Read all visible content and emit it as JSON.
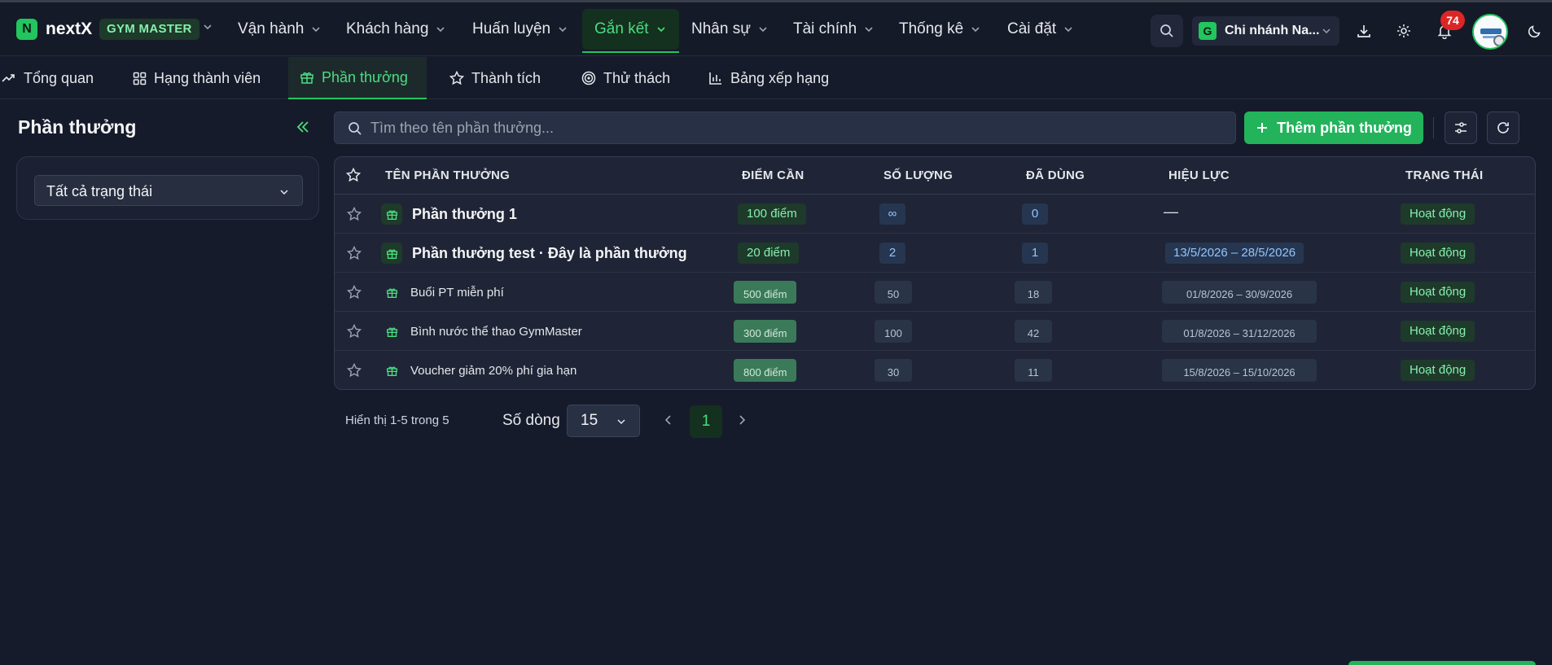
{
  "brand": {
    "logo_letter": "N",
    "name": "nextX",
    "badge": "GYM MASTER"
  },
  "nav": {
    "items": [
      {
        "label": "Vận hành"
      },
      {
        "label": "Khách hàng"
      },
      {
        "label": "Huấn luyện"
      },
      {
        "label": "Gắn kết",
        "active": true
      },
      {
        "label": "Nhân sự"
      },
      {
        "label": "Tài chính"
      },
      {
        "label": "Thống kê"
      },
      {
        "label": "Cài đặt"
      }
    ]
  },
  "header": {
    "branch_letter": "G",
    "branch_label": "Chi nhánh Na...",
    "notification_count": "74"
  },
  "subnav": {
    "tabs": [
      {
        "label": "Tổng quan",
        "icon": "trend-up-icon"
      },
      {
        "label": "Hạng thành viên",
        "icon": "grid-icon"
      },
      {
        "label": "Phần thưởng",
        "icon": "gift-icon",
        "active": true
      },
      {
        "label": "Thành tích",
        "icon": "star-icon"
      },
      {
        "label": "Thử thách",
        "icon": "target-icon"
      },
      {
        "label": "Bảng xếp hạng",
        "icon": "bar-chart-icon"
      }
    ]
  },
  "sidebar": {
    "title": "Phần thưởng",
    "filter_value": "Tất cả trạng thái"
  },
  "toolbar": {
    "search_placeholder": "Tìm theo tên phần thưởng...",
    "add_label": "Thêm phần thưởng"
  },
  "table": {
    "columns": [
      "TÊN PHẦN THƯỞNG",
      "ĐIỂM CẦN",
      "SỐ LƯỢNG",
      "ĐÃ DÙNG",
      "HIỆU LỰC",
      "TRẠNG THÁI"
    ],
    "rows": [
      {
        "name": "Phần thưởng 1",
        "points": "100 điểm",
        "quantity": "∞",
        "used": "0",
        "validity": "—",
        "status": "Hoạt động"
      },
      {
        "name": "Phần thưởng test · Đây là phần thưởng",
        "points": "20 điểm",
        "quantity": "2",
        "used": "1",
        "validity": "13/5/2026 – 28/5/2026",
        "status": "Hoạt động"
      },
      {
        "name": "Buổi PT miễn phí",
        "points": "500 điểm",
        "quantity": "50",
        "used": "18",
        "validity": "01/8/2026 – 30/9/2026",
        "status": "Hoạt động"
      },
      {
        "name": "Bình nước thể thao GymMaster",
        "points": "300 điểm",
        "quantity": "100",
        "used": "42",
        "validity": "01/8/2026 – 31/12/2026",
        "status": "Hoạt động"
      },
      {
        "name": "Voucher giảm 20% phí gia hạn",
        "points": "800 điểm",
        "quantity": "30",
        "used": "11",
        "validity": "15/8/2026 – 15/10/2026",
        "status": "Hoạt động"
      }
    ]
  },
  "pagination": {
    "showing": "Hiển thị 1-5 trong 5",
    "rows_label": "Số dòng",
    "rows_value": "15",
    "current_page": "1"
  },
  "colors": {
    "accent": "#22c55e",
    "background": "#161b2b",
    "danger": "#dc2626"
  }
}
